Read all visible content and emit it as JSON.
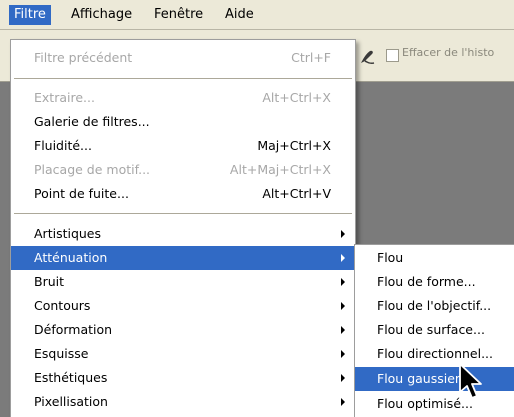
{
  "menubar": {
    "items": [
      {
        "label": "Filtre",
        "active": true
      },
      {
        "label": "Affichage"
      },
      {
        "label": "Fenêtre"
      },
      {
        "label": "Aide"
      }
    ]
  },
  "options_bar": {
    "erase_history_label": "Effacer de l'histo"
  },
  "filter_menu": {
    "previous_filter": {
      "label": "Filtre précédent",
      "shortcut": "Ctrl+F",
      "disabled": true
    },
    "items": [
      {
        "label": "Extraire...",
        "shortcut": "Alt+Ctrl+X",
        "disabled": true
      },
      {
        "label": "Galerie de filtres..."
      },
      {
        "label": "Fluidité...",
        "shortcut": "Maj+Ctrl+X"
      },
      {
        "label": "Placage de motif...",
        "shortcut": "Alt+Maj+Ctrl+X",
        "disabled": true
      },
      {
        "label": "Point de fuite...",
        "shortcut": "Alt+Ctrl+V"
      }
    ],
    "categories": [
      {
        "label": "Artistiques"
      },
      {
        "label": "Atténuation",
        "highlighted": true
      },
      {
        "label": "Bruit"
      },
      {
        "label": "Contours"
      },
      {
        "label": "Déformation"
      },
      {
        "label": "Esquisse"
      },
      {
        "label": "Esthétiques"
      },
      {
        "label": "Pixellisation"
      }
    ]
  },
  "blur_submenu": {
    "items": [
      {
        "label": "Flou"
      },
      {
        "label": "Flou de forme..."
      },
      {
        "label": "Flou de l'objectif..."
      },
      {
        "label": "Flou de surface..."
      },
      {
        "label": "Flou directionnel..."
      },
      {
        "label": "Flou gaussien...",
        "highlighted": true
      },
      {
        "label": "Flou optimisé..."
      }
    ]
  },
  "colors": {
    "highlight": "#316ac5",
    "menubar_bg": "#ece9d8",
    "workspace_bg": "#7b7b7b"
  }
}
